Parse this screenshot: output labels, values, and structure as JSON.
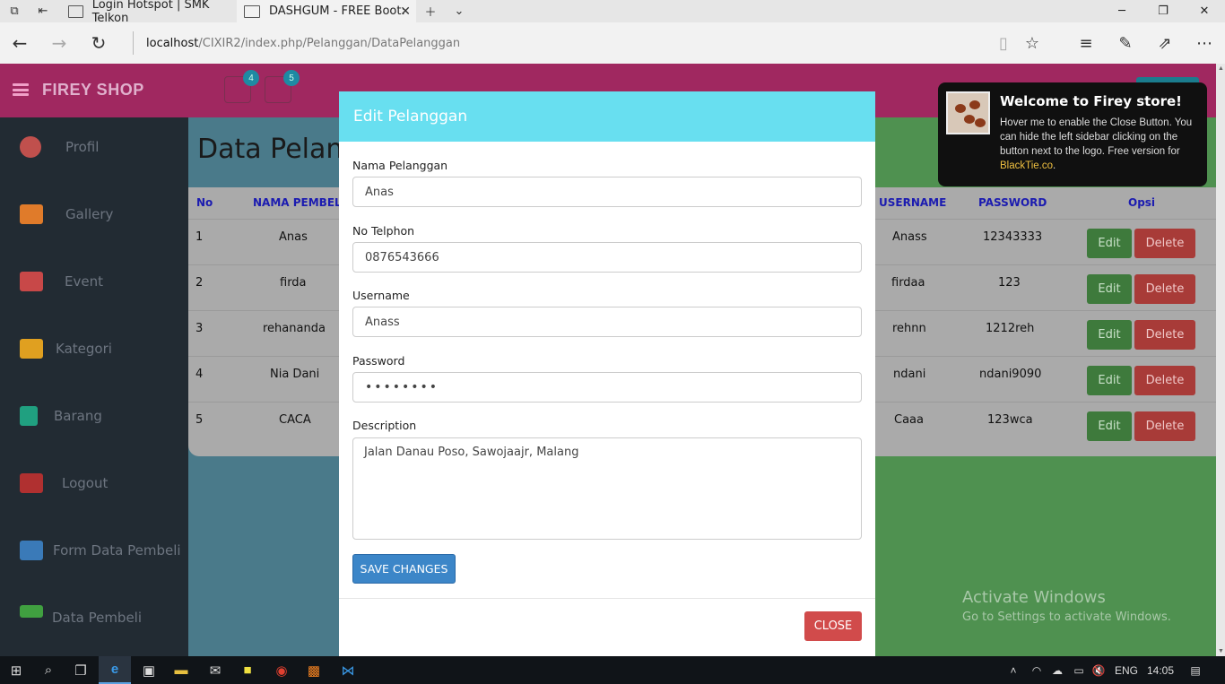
{
  "browser": {
    "tabs": [
      {
        "title": "Login Hotspot | SMK Telkon"
      },
      {
        "title": "DASHGUM - FREE Boot:"
      }
    ],
    "url_host": "localhost",
    "url_path": "/CIXIR2/index.php/Pelanggan/DataPelanggan"
  },
  "header": {
    "logo": "FIREY SHOP",
    "badge_tasks": "4",
    "badge_mail": "5"
  },
  "sidebar": {
    "items": [
      {
        "label": "Profil",
        "icon": "profile-icon",
        "color": "#c0504d"
      },
      {
        "label": "Gallery",
        "icon": "gallery-icon",
        "color": "#e07b2a"
      },
      {
        "label": "Event",
        "icon": "calendar-icon",
        "color": "#c84848"
      },
      {
        "label": "Kategori",
        "icon": "folder-icon",
        "color": "#e0a020"
      },
      {
        "label": "Barang",
        "icon": "download-icon",
        "color": "#20a080"
      },
      {
        "label": "Logout",
        "icon": "house-icon",
        "color": "#b03030"
      },
      {
        "label": "Form Data Pembeli",
        "icon": "form-icon",
        "color": "#3a7ab8"
      },
      {
        "label": "Data Pembeli",
        "icon": "check-icon",
        "color": "#40a040"
      }
    ]
  },
  "main": {
    "title": "Data Pelang",
    "columns": {
      "no": "No",
      "nama": "NAMA PEMBELI",
      "username": "USERNAME",
      "password": "PASSWORD",
      "opsi": "Opsi"
    },
    "rows": [
      {
        "no": "1",
        "nama": "Anas",
        "username": "Anass",
        "password": "12343333"
      },
      {
        "no": "2",
        "nama": "firda",
        "username": "firdaa",
        "password": "123"
      },
      {
        "no": "3",
        "nama": "rehananda",
        "username": "rehnn",
        "password": "1212reh"
      },
      {
        "no": "4",
        "nama": "Nia Dani",
        "username": "ndani",
        "password": "ndani9090"
      },
      {
        "no": "5",
        "nama": "CACA",
        "username": "Caaa",
        "password": "123wca"
      }
    ],
    "edit_label": "Edit",
    "delete_label": "Delete"
  },
  "toast": {
    "title": "Welcome to Firey store!",
    "body": "Hover me to enable the Close Button. You can hide the left sidebar clicking on the button next to the logo. Free version for ",
    "link": "BlackTie.co",
    "end": "."
  },
  "modal": {
    "title": "Edit Pelanggan",
    "nama_label": "Nama Pelanggan",
    "nama_value": "Anas",
    "telp_label": "No Telphon",
    "telp_value": "0876543666",
    "username_label": "Username",
    "username_value": "Anass",
    "password_label": "Password",
    "password_value": "••••••••",
    "desc_label": "Description",
    "desc_value": "Jalan Danau Poso, Sawojaajr, Malang",
    "save_label": "SAVE CHANGES",
    "close_label": "CLOSE"
  },
  "watermark": {
    "line1": "Activate Windows",
    "line2": "Go to Settings to activate Windows."
  },
  "taskbar": {
    "lang": "ENG",
    "time": "14:05"
  }
}
